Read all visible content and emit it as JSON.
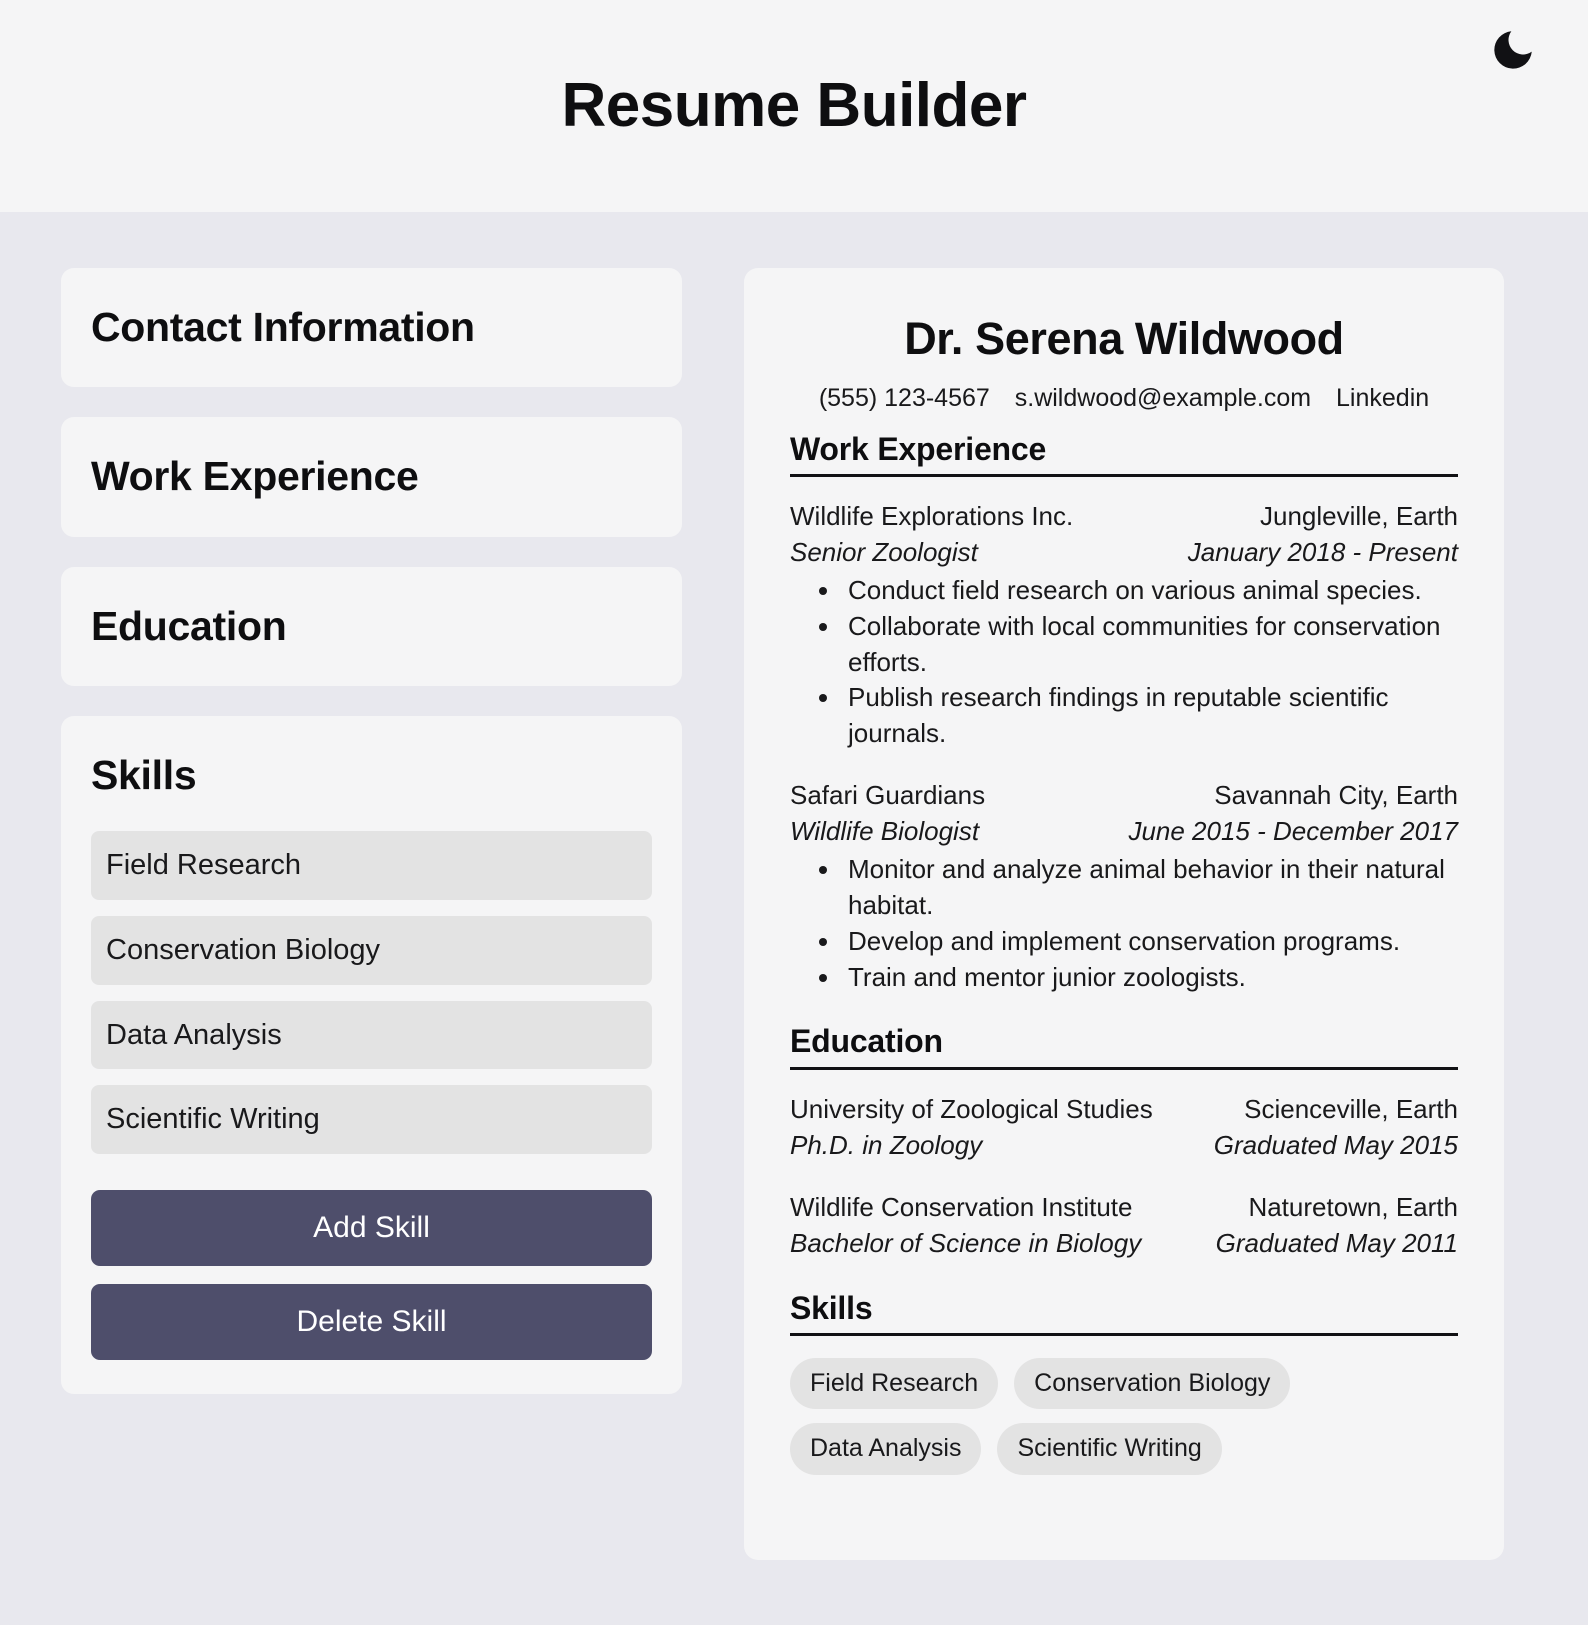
{
  "header": {
    "title": "Resume Builder",
    "theme_toggle_icon": "moon-icon"
  },
  "editor": {
    "sections": [
      {
        "label": "Contact Information"
      },
      {
        "label": "Work Experience"
      },
      {
        "label": "Education"
      }
    ],
    "skills_panel": {
      "label": "Skills",
      "items": [
        "Field Research",
        "Conservation Biology",
        "Data Analysis",
        "Scientific Writing"
      ],
      "add_label": "Add Skill",
      "delete_label": "Delete Skill"
    }
  },
  "resume": {
    "name": "Dr. Serena Wildwood",
    "contact": {
      "phone": "(555) 123-4567",
      "email": "s.wildwood@example.com",
      "link": "Linkedin"
    },
    "work": {
      "title": "Work Experience",
      "entries": [
        {
          "company": "Wildlife Explorations Inc.",
          "location": "Jungleville, Earth",
          "role": "Senior Zoologist",
          "dates": "January 2018 - Present",
          "bullets": [
            "Conduct field research on various animal species.",
            "Collaborate with local communities for conservation efforts.",
            "Publish research findings in reputable scientific journals."
          ]
        },
        {
          "company": "Safari Guardians",
          "location": "Savannah City, Earth",
          "role": "Wildlife Biologist",
          "dates": "June 2015 - December 2017",
          "bullets": [
            "Monitor and analyze animal behavior in their natural habitat.",
            "Develop and implement conservation programs.",
            "Train and mentor junior zoologists."
          ]
        }
      ]
    },
    "education": {
      "title": "Education",
      "entries": [
        {
          "school": "University of Zoological Studies",
          "location": "Scienceville, Earth",
          "degree": "Ph.D. in Zoology",
          "dates": "Graduated May 2015"
        },
        {
          "school": "Wildlife Conservation Institute",
          "location": "Naturetown, Earth",
          "degree": "Bachelor of Science in Biology",
          "dates": "Graduated May 2011"
        }
      ]
    },
    "skills": {
      "title": "Skills",
      "items": [
        "Field Research",
        "Conservation Biology",
        "Data Analysis",
        "Scientific Writing"
      ]
    }
  },
  "colors": {
    "page_background": "#e8e8ee",
    "card_background": "#f5f5f6",
    "button_accent": "#4e4e6b",
    "chip_background": "#e3e3e3",
    "text_primary": "#0e0e10"
  }
}
